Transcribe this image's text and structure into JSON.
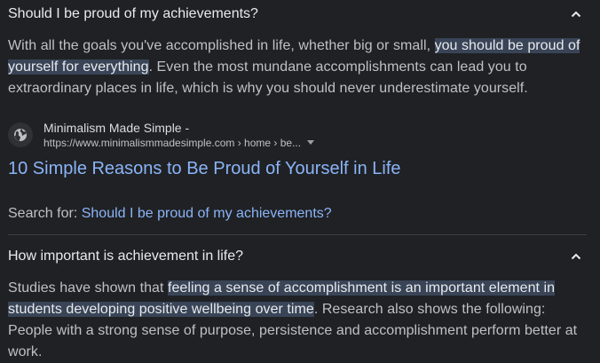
{
  "faq1": {
    "question": "Should I be proud of my achievements?",
    "answer": {
      "before": "With all the goals you've accomplished in life, whether big or small, ",
      "highlight": "you should be proud of yourself for everything",
      "after": ". Even the most mundane accomplishments can lead you to extraordinary places in life, which is why you should never underestimate yourself."
    },
    "source": {
      "icon": "globe-icon",
      "name": "Minimalism Made Simple -",
      "url": "https://www.minimalismmadesimple.com › home › be..."
    },
    "result_title": "10 Simple Reasons to Be Proud of Yourself in Life",
    "search_for_label": "Search for:",
    "search_for_query": "Should I be proud of my achievements?"
  },
  "faq2": {
    "question": "How important is achievement in life?",
    "answer": {
      "before": "Studies have shown that ",
      "highlight": "feeling a sense of accomplishment is an important element in students developing positive wellbeing over time",
      "after": ". Research also shows the following: People with a strong sense of purpose, persistence and accomplishment perform better at work."
    }
  },
  "colors": {
    "background": "#202124",
    "link": "#8ab4f8",
    "highlight": "#394457",
    "text": "#bdc1c6"
  }
}
